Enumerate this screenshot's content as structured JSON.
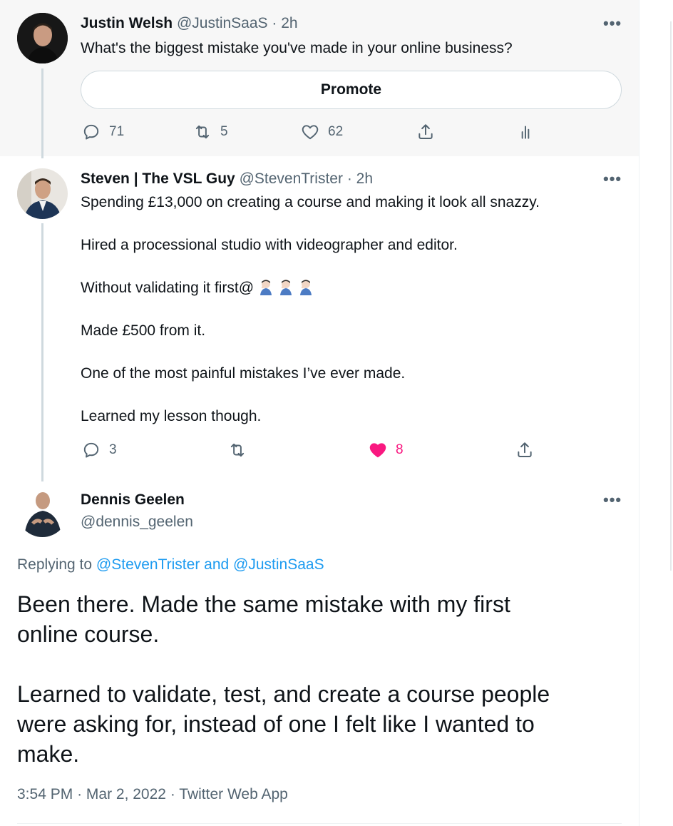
{
  "tweets": [
    {
      "name": "Justin Welsh",
      "handle": "@JustinSaaS",
      "time": "· 2h",
      "text": "What's the biggest mistake you've made in your online business?",
      "promote_label": "Promote",
      "actions": {
        "replies": "71",
        "retweets": "5",
        "likes": "62"
      }
    },
    {
      "name": "Steven | The VSL Guy",
      "handle": "@StevenTrister",
      "time": "· 2h",
      "lines": [
        "Spending £13,000 on creating a course and making it look all snazzy.",
        "Hired a processional studio with videographer and editor.",
        "Without validating it first@",
        "Made £500 from it.",
        "One of the most painful mistakes I’ve ever made.",
        "Learned my lesson though."
      ],
      "emoji": "facepalm-emoji",
      "actions": {
        "replies": "3",
        "likes": "8"
      }
    }
  ],
  "main_tweet": {
    "name": "Dennis Geelen",
    "handle": "@dennis_geelen",
    "replying_prefix": "Replying to",
    "replying_to": "@StevenTrister and @JustinSaaS",
    "lines": [
      "Been there.  Made the same mistake with my first",
      "online course.",
      "Learned to validate, test, and create a course people",
      "were asking for, instead of one I felt like I wanted to",
      "make."
    ],
    "time": "3:54 PM",
    "date": "Mar 2, 2022",
    "source": "Twitter Web App",
    "separator": "·"
  },
  "more_label": "•••",
  "colors": {
    "link": "#1d9bf0",
    "like": "#f91880",
    "muted": "#536471",
    "line": "#cfd9de"
  }
}
